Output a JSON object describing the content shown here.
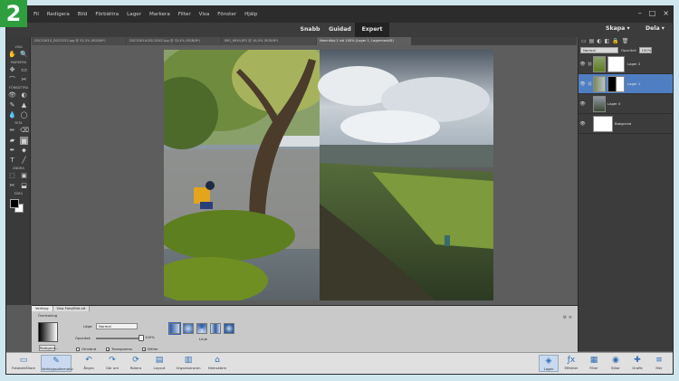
{
  "step_number": "2",
  "menu": {
    "items": [
      "Fil",
      "Redigera",
      "Bild",
      "Förbättra",
      "Lager",
      "Markera",
      "Filter",
      "Visa",
      "Fönster",
      "Hjälp"
    ]
  },
  "window_controls": [
    "–",
    "□",
    "×"
  ],
  "modes": [
    {
      "label": "Snabb",
      "active": false
    },
    {
      "label": "Guidad",
      "active": false
    },
    {
      "label": "Expert",
      "active": true
    }
  ],
  "top_right": {
    "create_label": "Skapa",
    "share_label": "Dela"
  },
  "doc_tabs": [
    {
      "label": "DSC02610_DSC0252.jpg @ 33,3% (RGB/8*)",
      "active": false
    },
    {
      "label": "DSC02616-DSC0262.jpg @ 33,4% (RGB/8*)",
      "active": false
    },
    {
      "label": "IMG_6944.JPG @ 16,4% (RGB/8*)",
      "active": false
    },
    {
      "label": "Namnlöst-1 vid 100% (Lager 1, Lagermask/8)",
      "active": true
    }
  ],
  "toolbar": {
    "groups": [
      "VISA",
      "MARKERA",
      "FÖRBÄTTRA",
      "RITA",
      "ÄNDRA",
      "FÄRG"
    ],
    "tools": [
      [
        "✋",
        "🔍"
      ],
      [
        "✥",
        "▭"
      ],
      [
        "⌒",
        "✂"
      ],
      [
        "👁",
        "◐"
      ],
      [
        "✎",
        "▲"
      ],
      [
        "💧",
        "◯"
      ],
      [
        "✏",
        "⌫"
      ],
      [
        "▰",
        "■"
      ],
      [
        "✒",
        "⬥"
      ],
      [
        "T",
        "╱"
      ],
      [
        "⬚",
        "▣"
      ],
      [
        "✂",
        "⬓"
      ]
    ]
  },
  "layers_panel": {
    "blend_mode": "Normal",
    "opacity_label": "Opacitet:",
    "opacity_value": "100%",
    "layers": [
      {
        "name": "Lager 2",
        "selected": false,
        "has_mask": true
      },
      {
        "name": "Lager 1",
        "selected": true,
        "has_mask": true
      },
      {
        "name": "Lager 0",
        "selected": false,
        "has_mask": false
      },
      {
        "name": "Bakgrund",
        "selected": false,
        "has_mask": false
      }
    ]
  },
  "tool_options": {
    "tabs": [
      "Verktyg",
      "Visa Foto/Bild alt"
    ],
    "tool_name": "Övertoning",
    "edit_label": "Redigera...",
    "mode_label": "Läge:",
    "mode_value": "Normal",
    "opacity_label": "Opacitet:",
    "opacity_value": "100%",
    "opacity_fraction": 1.0,
    "checkboxes": [
      {
        "label": "Omvänd",
        "checked": false
      },
      {
        "label": "Transparens",
        "checked": true
      },
      {
        "label": "Dither",
        "checked": true
      }
    ],
    "type_label": "Linje"
  },
  "bottom_bar": {
    "left": [
      {
        "icon": "▭",
        "label": "Fotobehållare"
      },
      {
        "icon": "✎",
        "label": "Verktygsalternativ"
      },
      {
        "icon": "↶",
        "label": "Ångra"
      },
      {
        "icon": "↷",
        "label": "Gör om"
      },
      {
        "icon": "⟳",
        "label": "Rotera"
      },
      {
        "icon": "▤",
        "label": "Layout"
      },
      {
        "icon": "▥",
        "label": "Organiseraren"
      },
      {
        "icon": "⌂",
        "label": "Hemskärm"
      }
    ],
    "right": [
      {
        "icon": "◈",
        "label": "Lager"
      },
      {
        "icon": "ƒx",
        "label": "Effekter"
      },
      {
        "icon": "▦",
        "label": "Filter"
      },
      {
        "icon": "◉",
        "label": "Stilar"
      },
      {
        "icon": "✚",
        "label": "Grafik"
      },
      {
        "icon": "≡",
        "label": "Mer"
      }
    ]
  }
}
